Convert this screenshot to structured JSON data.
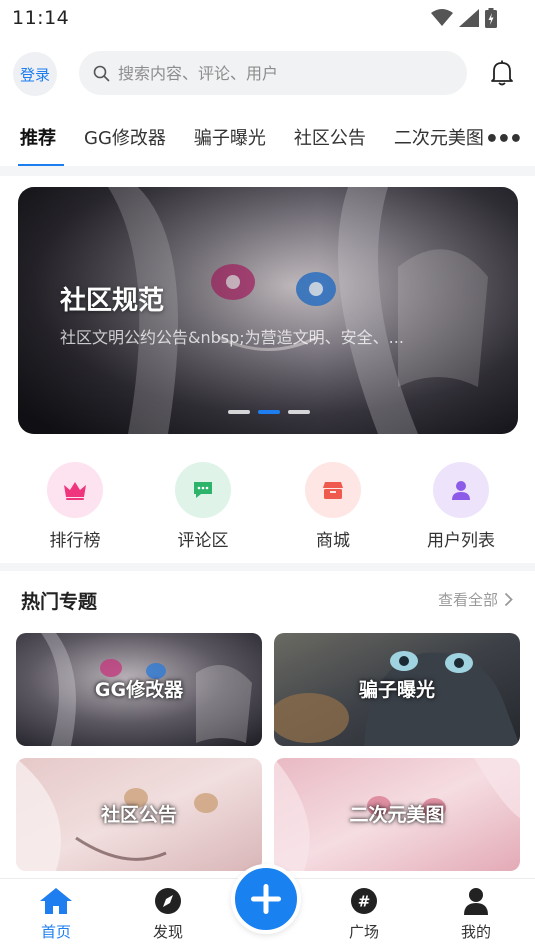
{
  "status": {
    "time": "11:14"
  },
  "header": {
    "login_label": "登录",
    "search_placeholder": "搜索内容、评论、用户"
  },
  "tabs": [
    {
      "label": "推荐",
      "active": true
    },
    {
      "label": "GG修改器"
    },
    {
      "label": "骗子曝光"
    },
    {
      "label": "社区公告"
    },
    {
      "label": "二次元美图"
    }
  ],
  "banner": {
    "title": "社区规范",
    "subtitle": "社区文明公约公告&nbsp;为营造文明、安全、...",
    "slide_count": 3,
    "active_slide": 2
  },
  "quick_entries": [
    {
      "label": "排行榜",
      "icon": "crown-icon",
      "bg": "#fde3ef",
      "fg": "#f0357f"
    },
    {
      "label": "评论区",
      "icon": "comment-icon",
      "bg": "#dff3e8",
      "fg": "#2db46a"
    },
    {
      "label": "商城",
      "icon": "shop-icon",
      "bg": "#fde6e4",
      "fg": "#ef5a4f"
    },
    {
      "label": "用户列表",
      "icon": "user-icon",
      "bg": "#ede4fb",
      "fg": "#8c5ce8"
    }
  ],
  "topics": {
    "title": "热门专题",
    "see_all": "查看全部",
    "cards": [
      {
        "label": "GG修改器",
        "theme": "dark"
      },
      {
        "label": "骗子曝光",
        "theme": "cat"
      },
      {
        "label": "社区公告",
        "theme": "pink"
      },
      {
        "label": "二次元美图",
        "theme": "pink2"
      }
    ]
  },
  "bottom_nav": [
    {
      "label": "首页",
      "icon": "home-icon",
      "active": true
    },
    {
      "label": "发现",
      "icon": "compass-icon"
    },
    {
      "label": "广场",
      "icon": "hash-icon"
    },
    {
      "label": "我的",
      "icon": "profile-icon"
    }
  ],
  "colors": {
    "accent": "#1e7ef0"
  }
}
